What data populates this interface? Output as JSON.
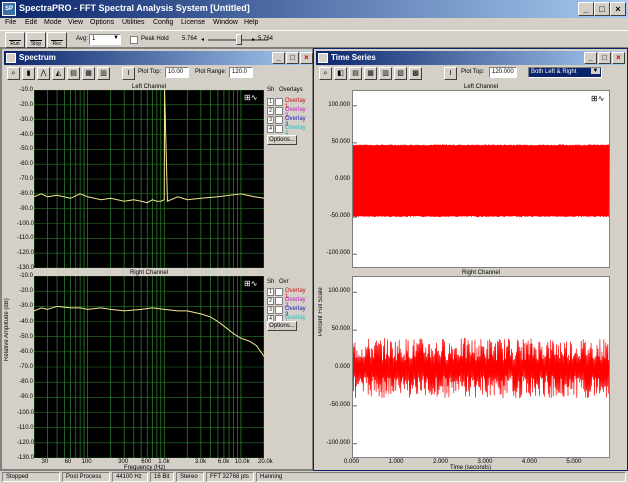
{
  "window": {
    "title": "SpectraPRO - FFT Spectral Analysis System [Untitled]",
    "app_icon": "spectrapro-logo"
  },
  "menu": [
    "File",
    "Edit",
    "Mode",
    "View",
    "Options",
    "Utilities",
    "Config",
    "License",
    "Window",
    "Help"
  ],
  "toolbar": {
    "run_label": "Run",
    "stop_label": "Stop",
    "rec_label": "Rec",
    "avg_label": "Avg:",
    "avg_value": "1",
    "peak_hold_label": "Peak Hold",
    "peak_value_left": "5.764",
    "peak_value_right": "5.764"
  },
  "spectrum_window": {
    "title": "Spectrum",
    "plot_top_label": "Plot Top:",
    "plot_top_value": "10.00",
    "plot_range_label": "Plot Range:",
    "plot_range_value": "120.0",
    "ylabel": "Relative Amplitude (dB)",
    "xlabel": "Frequency (Hz)",
    "left_caption": "Left Channel",
    "right_caption": "Right Channel",
    "overlays_header": "Overlays",
    "overlays_header_right": "Ovr",
    "show_header": "Sh",
    "overlays": [
      {
        "n": "1",
        "label": "Overlay 1",
        "color": "#d01010"
      },
      {
        "n": "2",
        "label": "Overlay 2",
        "color": "#c020c0"
      },
      {
        "n": "3",
        "label": "Overlay 3",
        "color": "#2020c0"
      },
      {
        "n": "4",
        "label": "Overlay 4",
        "color": "#20c0c0"
      }
    ],
    "options_label": "Options..."
  },
  "time_window": {
    "title": "Time Series",
    "plot_top_label": "Plot Top:",
    "plot_top_value": "120.000",
    "channel_select": "Both Left & Right",
    "ylabel": "Percent Full Scale",
    "xlabel": "Time (seconds)",
    "left_caption": "Left Channel",
    "right_caption": "Right Channel"
  },
  "status": [
    "Stopped",
    "Post Process",
    "44100 Hz",
    "16 Bit",
    "Stereo",
    "FFT 32768 pts",
    "Hanning"
  ],
  "chart_data": [
    {
      "type": "line",
      "title": "Left Channel",
      "xlabel": "Frequency (Hz)",
      "ylabel": "Relative Amplitude (dB)",
      "xscale": "log",
      "xlim": [
        20,
        20000
      ],
      "ylim": [
        -130,
        -10
      ],
      "x_ticks": [
        "30",
        "60",
        "100",
        "300",
        "600",
        "1.0k",
        "3.0k",
        "6.0k",
        "10.0k",
        "20.0k"
      ],
      "y_ticks": [
        "-10.0",
        "-20.0",
        "-30.0",
        "-40.0",
        "-50.0",
        "-60.0",
        "-70.0",
        "-80.0",
        "-90.0",
        "-100.0",
        "-110.0",
        "-120.0",
        "-130.0"
      ],
      "grid": true,
      "series": [
        {
          "color": "#f0e890",
          "x": [
            20,
            25,
            30,
            40,
            60,
            80,
            100,
            150,
            200,
            300,
            400,
            500,
            600,
            700,
            800,
            900,
            1000,
            1010,
            1100,
            1500,
            2000,
            3000,
            5000,
            7000,
            10000,
            15000,
            20000
          ],
          "y": [
            -82,
            -80,
            -82,
            -81,
            -83,
            -80,
            -82,
            -84,
            -83,
            -85,
            -84,
            -85,
            -86,
            -84,
            -85,
            -85,
            -84,
            -10,
            -85,
            -82,
            -84,
            -83,
            -82,
            -81,
            -80,
            -82,
            -83
          ]
        }
      ]
    },
    {
      "type": "line",
      "title": "Right Channel",
      "xlabel": "Frequency (Hz)",
      "ylabel": "Relative Amplitude (dB)",
      "xscale": "log",
      "xlim": [
        20,
        20000
      ],
      "ylim": [
        -130,
        -10
      ],
      "x_ticks": [
        "30",
        "60",
        "100",
        "300",
        "600",
        "1.0k",
        "3.0k",
        "6.0k",
        "10.0k",
        "20.0k"
      ],
      "y_ticks": [
        "-10.0",
        "-20.0",
        "-30.0",
        "-40.0",
        "-50.0",
        "-60.0",
        "-70.0",
        "-80.0",
        "-90.0",
        "-100.0",
        "-110.0",
        "-120.0",
        "-130.0"
      ],
      "grid": true,
      "series": [
        {
          "color": "#f0e890",
          "x": [
            20,
            25,
            30,
            40,
            60,
            80,
            100,
            150,
            200,
            300,
            500,
            700,
            1000,
            1500,
            2000,
            3000,
            4000,
            5000,
            6000,
            8000,
            10000,
            13000,
            16000,
            20000
          ],
          "y": [
            -33,
            -31,
            -32,
            -30,
            -31,
            -31,
            -32,
            -31,
            -32,
            -33,
            -32,
            -31,
            -32,
            -33,
            -33,
            -35,
            -37,
            -40,
            -43,
            -48,
            -51,
            -53,
            -56,
            -63
          ]
        }
      ]
    },
    {
      "type": "line",
      "title": "Left Channel",
      "xlabel": "Time (seconds)",
      "ylabel": "Percent Full Scale",
      "xlim": [
        0,
        5.8
      ],
      "ylim": [
        -120,
        120
      ],
      "x_ticks": [
        "0.000",
        "1.000",
        "2.000",
        "3.000",
        "4.000",
        "5.000"
      ],
      "y_ticks": [
        "100.000",
        "50.000",
        "0.000",
        "-50.000",
        "-100.000"
      ],
      "series": [
        {
          "color": "#ff0000",
          "envelope_max": 48,
          "envelope_min": -50
        }
      ]
    },
    {
      "type": "line",
      "title": "Right Channel",
      "xlabel": "Time (seconds)",
      "ylabel": "Percent Full Scale",
      "xlim": [
        0,
        5.8
      ],
      "ylim": [
        -120,
        120
      ],
      "x_ticks": [
        "0.000",
        "1.000",
        "2.000",
        "3.000",
        "4.000",
        "5.000"
      ],
      "y_ticks": [
        "100.000",
        "50.000",
        "0.000",
        "-50.000",
        "-100.000"
      ],
      "series": [
        {
          "color": "#ff0000",
          "envelope_max": 40,
          "envelope_min": -40
        }
      ]
    }
  ]
}
